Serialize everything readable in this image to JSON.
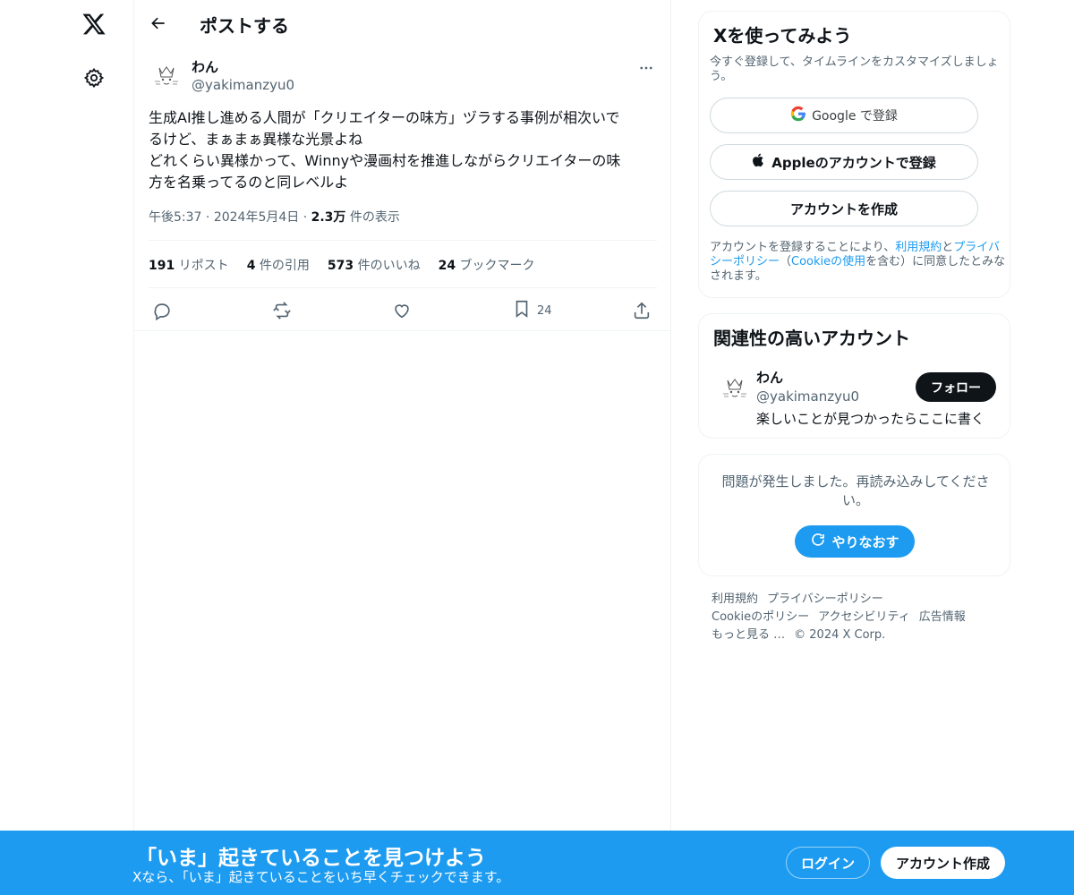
{
  "colors": {
    "accent": "#1d9bf0",
    "text": "#0f1419",
    "secondary": "#536471",
    "border": "#eff3f4"
  },
  "nav": {
    "logo_icon": "x-logo-icon",
    "settings_icon": "gear-icon"
  },
  "header": {
    "back_icon": "arrow-left-icon",
    "title": "ポストする"
  },
  "tweet": {
    "author_name": "わん",
    "author_handle": "@yakimanzyu0",
    "more_icon": "more-horizontal-icon",
    "text_lines": [
      "生成AI推し進める人間が「クリエイターの味方」ヅラする事例が相次いで",
      "るけど、まぁまぁ異様な光景よね",
      "どれくらい異様かって、Winnyや漫画村を推進しながらクリエイターの味",
      "方を名乗ってるのと同レベルよ"
    ],
    "time": "午後5:37",
    "date": "2024年5月4日",
    "views_count": "2.3万",
    "views_label": "件の表示",
    "stats": {
      "reposts_count": "191",
      "reposts_label": "リポスト",
      "quotes_count": "4",
      "quotes_label": "件の引用",
      "likes_count": "573",
      "likes_label": "件のいいね",
      "bookmarks_count": "24",
      "bookmarks_label": "ブックマーク"
    },
    "actions": {
      "reply_icon": "reply-icon",
      "repost_icon": "repost-icon",
      "like_icon": "heart-icon",
      "bookmark_icon": "bookmark-icon",
      "bookmark_count": "24",
      "share_icon": "share-icon"
    }
  },
  "signup_card": {
    "title": "Xを使ってみよう",
    "subtitle": "今すぐ登録して、タイムラインをカスタマイズしましょう。",
    "google_label": "Google で登録",
    "apple_label": "Appleのアカウントで登録",
    "create_label": "アカウントを作成",
    "legal_prefix": "アカウントを登録することにより、",
    "legal_terms": "利用規約",
    "legal_and": "と",
    "legal_privacy": "プライバシーポリシー",
    "legal_open": "（",
    "legal_cookie": "Cookieの使用",
    "legal_suffix": "を含む）に同意したとみなされます。"
  },
  "relevant_card": {
    "title": "関連性の高いアカウント",
    "name": "わん",
    "handle": "@yakimanzyu0",
    "bio": "楽しいことが見つかったらここに書く",
    "follow_label": "フォロー"
  },
  "error_card": {
    "message": "問題が発生しました。再読み込みしてください。",
    "retry_label": "やりなおす"
  },
  "footer": {
    "terms": "利用規約",
    "privacy": "プライバシーポリシー",
    "cookie": "Cookieのポリシー",
    "accessibility": "アクセシビリティ",
    "ads": "広告情報",
    "more": "もっと見る …",
    "copyright": "© 2024 X Corp."
  },
  "banner": {
    "title": "「いま」起きていることを見つけよう",
    "subtitle": "Xなら、「いま」起きていることをいち早くチェックできます。",
    "login_label": "ログイン",
    "signup_label": "アカウント作成"
  }
}
